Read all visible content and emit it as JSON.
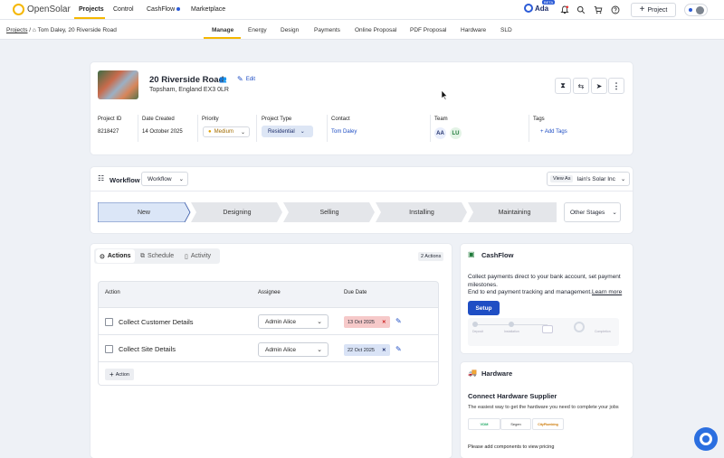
{
  "topbar": {
    "logo_text": "OpenSolar",
    "nav": [
      "Projects",
      "Control",
      "CashFlow",
      "Marketplace"
    ],
    "ada_label": "Ada",
    "beta_label": "BETA",
    "project_button": "Project"
  },
  "subbar": {
    "breadcrumb_root": "Projects",
    "breadcrumb_sep": "/",
    "breadcrumb_current": "Tom Daley, 20 Riverside Road",
    "tabs": [
      "Manage",
      "Energy",
      "Design",
      "Payments",
      "Online Proposal",
      "PDF Proposal",
      "Hardware",
      "SLD"
    ]
  },
  "project": {
    "address": "20 Riverside Road",
    "city": "Topsham, England EX3 0LR",
    "edit_label": "Edit",
    "fields": {
      "id_label": "Project ID",
      "id": "8218427",
      "date_label": "Date Created",
      "date": "14 October 2025",
      "priority_label": "Priority",
      "priority": "Medium",
      "type_label": "Project Type",
      "type": "Residential",
      "contact_label": "Contact",
      "contact": "Tom Daley",
      "team_label": "Team",
      "team_a": "AA",
      "team_b": "LU",
      "tags_label": "Tags",
      "add_tags": "Add Tags"
    }
  },
  "workflow": {
    "title": "Workflow",
    "select": "Workflow",
    "view_as_label": "View As",
    "view_as_value": "Iain's Solar Inc",
    "stages": [
      "New",
      "Designing",
      "Selling",
      "Installing",
      "Maintaining"
    ],
    "other_stages": "Other Stages"
  },
  "actions": {
    "tabs": [
      "Actions",
      "Schedule",
      "Activity"
    ],
    "count": "2 Actions",
    "headers": [
      "Action",
      "Assignee",
      "Due Date"
    ],
    "rows": [
      {
        "task": "Collect Customer Details",
        "assignee": "Admin Alice",
        "due": "13 Oct 2025",
        "overdue": true
      },
      {
        "task": "Collect Site Details",
        "assignee": "Admin Alice",
        "due": "22 Oct 2025",
        "overdue": false
      }
    ],
    "add_label": "Action"
  },
  "cashflow": {
    "title": "CashFlow",
    "line1": "Collect payments direct to your bank account, set payment milestones.",
    "line2": "End to end payment tracking and management.",
    "learn_more": "Learn more",
    "setup": "Setup",
    "illustration_labels": [
      "Deposit",
      "Installation",
      "Completion"
    ]
  },
  "hardware": {
    "title": "Hardware",
    "heading": "Connect Hardware Supplier",
    "desc": "The easiest way to get the hardware you need to complete your jobs",
    "note": "Please add components to view pricing",
    "suppliers": [
      "VDM",
      "Segen",
      "CityPlumbing"
    ]
  },
  "colors": {
    "brand": "#f5b700",
    "primary": "#1f4ec4",
    "overdue_bg": "#f6c9c9",
    "due_bg": "#d9e3f6"
  }
}
